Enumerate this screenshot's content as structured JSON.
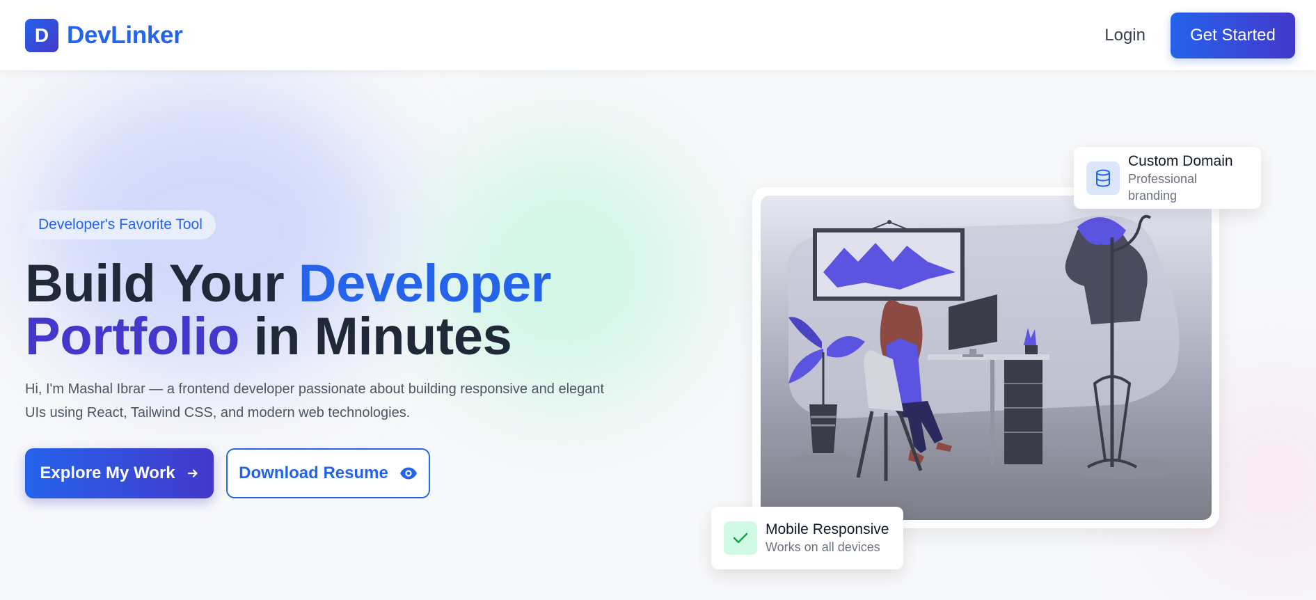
{
  "header": {
    "logo_letter": "D",
    "brand_name": "DevLinker",
    "login_label": "Login",
    "get_started_label": "Get Started"
  },
  "hero": {
    "badge": "Developer's Favorite Tool",
    "headline_part1": "Build Your ",
    "headline_part2": "Developer",
    "headline_part3": "Portfolio",
    "headline_part4": " in Minutes",
    "intro": "Hi, I'm Mashal Ibrar — a frontend developer passionate about building responsive and elegant UIs using React, Tailwind CSS, and modern web technologies.",
    "explore_label": "Explore My Work",
    "resume_label": "Download Resume"
  },
  "features": {
    "custom_domain": {
      "title": "Custom Domain",
      "subtitle": "Professional branding",
      "icon": "database-icon"
    },
    "mobile_responsive": {
      "title": "Mobile Responsive",
      "subtitle": "Works on all devices",
      "icon": "check-icon"
    }
  },
  "colors": {
    "primary": "#2563eb",
    "secondary": "#4338ca",
    "text_dark": "#1f2937",
    "text_muted": "#4b5563",
    "success": "#16a34a"
  }
}
